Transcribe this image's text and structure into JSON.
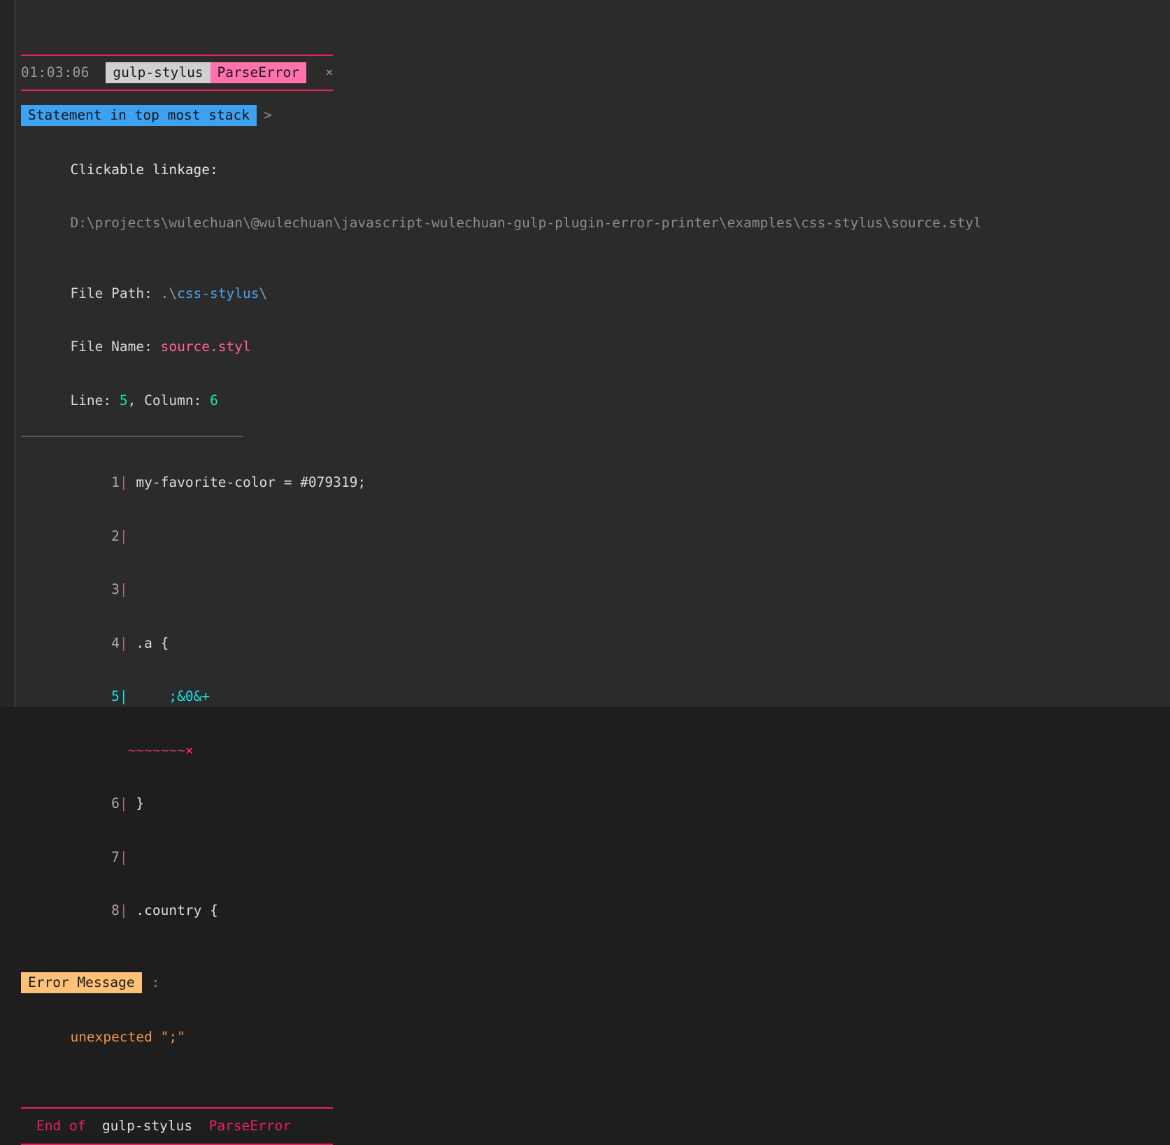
{
  "header": {
    "timestamp": "01:03:06",
    "plugin_name": "gulp-stylus",
    "error_type": "ParseError",
    "close_icon": "×"
  },
  "stack": {
    "badge_label": "Statement in top most stack",
    "chevron": ">"
  },
  "linkage": {
    "label": "Clickable linkage:",
    "path": "D:\\projects\\wulechuan\\@wulechuan\\javascript-wulechuan-gulp-plugin-error-printer\\examples\\css-stylus\\source.styl"
  },
  "file_meta": {
    "file_path_label": "File Path: ",
    "file_path_prefix": ".\\",
    "file_path_dir": "css-stylus",
    "file_path_suffix": "\\",
    "file_name_label": "File Name: ",
    "file_name": "source.styl",
    "line_label": "Line: ",
    "line_number": "5",
    "column_separator": ", Column: ",
    "column_number": "6"
  },
  "code": {
    "lines": [
      {
        "number": "1",
        "pipe": "|",
        "text": " my-favorite-color = #079319;",
        "error": false
      },
      {
        "number": "2",
        "pipe": "|",
        "text": "",
        "error": false
      },
      {
        "number": "3",
        "pipe": "|",
        "text": "",
        "error": false
      },
      {
        "number": "4",
        "pipe": "|",
        "text": " .a {",
        "error": false
      },
      {
        "number": "5",
        "pipe": "|",
        "text": "     ;&0&+",
        "error": true
      },
      {
        "number": "6",
        "pipe": "|",
        "text": " }",
        "error": false
      },
      {
        "number": "7",
        "pipe": "|",
        "text": "",
        "error": false
      },
      {
        "number": "8",
        "pipe": "|",
        "text": " .country {",
        "error": false
      }
    ],
    "marker_indent": "     ",
    "marker_tildes": "~~~~~~~",
    "marker_cross": "✕"
  },
  "error_message": {
    "badge_label": "Error Message",
    "colon": ":",
    "body": "unexpected \";\""
  },
  "footer": {
    "end_of_label": "End of",
    "plugin_name": "gulp-stylus",
    "error_type": "ParseError"
  },
  "colors": {
    "accent_crimson": "#e8225f",
    "badge_plugin_bg": "#d0d0d0",
    "badge_error_bg": "#ff72ad",
    "badge_stack_bg": "#3da2f2",
    "badge_errmsg_bg": "#ffc078",
    "error_cyan": "#17e0e0",
    "number_green": "#1fe3a0",
    "dir_blue": "#4da3f0",
    "file_pink": "#ff5f9e",
    "message_orange": "#f0934a",
    "background": "#2b2b2b"
  }
}
